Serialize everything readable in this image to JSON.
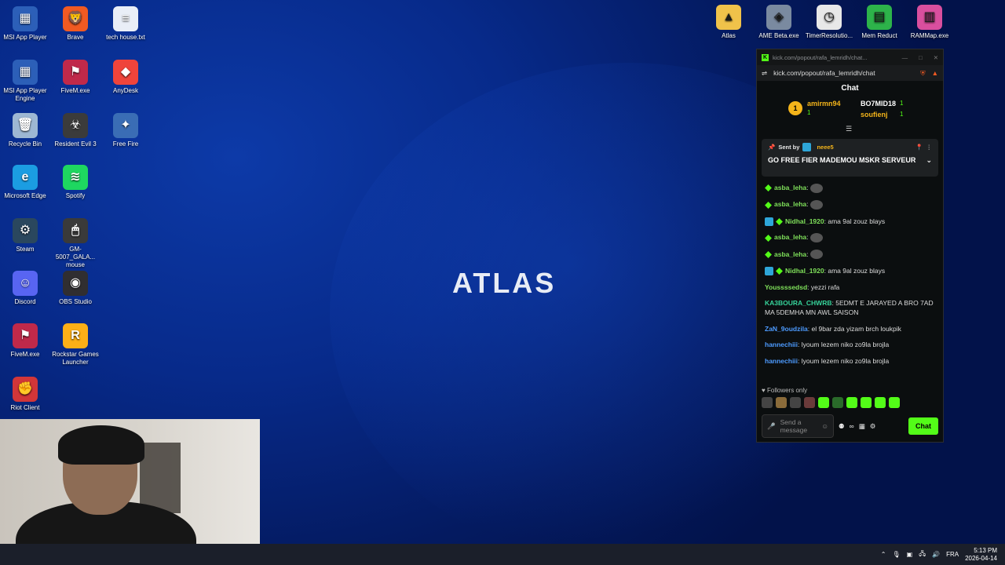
{
  "desktop": {
    "logo_text": "ATLAS",
    "icons_left": [
      {
        "label": "MSI App Player",
        "icon": "msi-app-player-icon",
        "color": "#2c5fb8",
        "glyph": "▦"
      },
      {
        "label": "Brave",
        "icon": "brave-icon",
        "color": "#f15a22",
        "glyph": "🦁"
      },
      {
        "label": "tech house.txt",
        "icon": "text-file-icon",
        "color": "#e9eef7",
        "glyph": "≡"
      },
      {
        "label": "MSI App Player Engine",
        "icon": "msi-engine-icon",
        "color": "#2c5fb8",
        "glyph": "▦"
      },
      {
        "label": "FiveM.exe",
        "icon": "fivem-icon",
        "color": "#c0294a",
        "glyph": "⚑"
      },
      {
        "label": "AnyDesk",
        "icon": "anydesk-icon",
        "color": "#ef443b",
        "glyph": "◆"
      },
      {
        "label": "Recycle Bin",
        "icon": "recycle-bin-icon",
        "color": "#9db7d3",
        "glyph": "🗑"
      },
      {
        "label": "Resident Evil 3",
        "icon": "resident-evil-icon",
        "color": "#3b3b3b",
        "glyph": "☣"
      },
      {
        "label": "Free Fire",
        "icon": "free-fire-icon",
        "color": "#3a6db5",
        "glyph": "✦"
      },
      {
        "label": "Microsoft Edge",
        "icon": "edge-icon",
        "color": "#1b9de2",
        "glyph": "e"
      },
      {
        "label": "Spotify",
        "icon": "spotify-icon",
        "color": "#1ed760",
        "glyph": "≋"
      },
      {
        "label": "Steam",
        "icon": "steam-icon",
        "color": "#2a475e",
        "glyph": "⚙"
      },
      {
        "label": "GM-5007_GALA... mouse",
        "icon": "mouse-app-icon",
        "color": "#3a3a3a",
        "glyph": "🖱"
      },
      {
        "label": "Discord",
        "icon": "discord-icon",
        "color": "#5865f2",
        "glyph": "☺"
      },
      {
        "label": "OBS Studio",
        "icon": "obs-icon",
        "color": "#302e31",
        "glyph": "◉"
      },
      {
        "label": "FiveM.exe",
        "icon": "fivem-icon",
        "color": "#c0294a",
        "glyph": "⚑"
      },
      {
        "label": "Rockstar Games Launcher",
        "icon": "rockstar-icon",
        "color": "#fcaf17",
        "glyph": "R"
      },
      {
        "label": "Riot Client",
        "icon": "riot-icon",
        "color": "#d13639",
        "glyph": "✊"
      }
    ],
    "icons_top": [
      {
        "label": "Atlas",
        "icon": "folder-icon",
        "color": "#f0c24a",
        "glyph": "▲"
      },
      {
        "label": "AME Beta.exe",
        "icon": "ame-icon",
        "color": "#7a8aa0",
        "glyph": "◈"
      },
      {
        "label": "TimerResolutio...",
        "icon": "clock-icon",
        "color": "#e8e8e8",
        "glyph": "◷"
      },
      {
        "label": "Mem Reduct",
        "icon": "mem-reduct-icon",
        "color": "#2db34a",
        "glyph": "▤"
      },
      {
        "label": "RAMMap.exe",
        "icon": "rammap-icon",
        "color": "#d94f9e",
        "glyph": "▥"
      }
    ]
  },
  "chat_window": {
    "tab_title": "kick.com/popout/rafa_lemridh/chat...",
    "url": "kick.com/popout/rafa_lemridh/chat",
    "header": "Chat",
    "leaders": [
      {
        "rank": "1",
        "name": "amirmn94",
        "count": "1"
      },
      {
        "name": "BO7MID18",
        "count": "1"
      },
      {
        "name": "soufienj",
        "count": "1"
      }
    ],
    "pinned": {
      "sent_by_label": "Sent by",
      "sender": "neee5",
      "message": "GO FREE FIER MADEMOU MSKR SERVEUR"
    },
    "messages": [
      {
        "user": "asba_leha",
        "text": "",
        "color": "#7fe05a",
        "emote": true,
        "badges": "g"
      },
      {
        "user": "asba_leha",
        "text": "",
        "color": "#7fe05a",
        "emote": true,
        "badges": "g"
      },
      {
        "user": "Nidhal_1920",
        "text": "ama 9al zouz blays",
        "color": "#7fe05a",
        "emote": false,
        "badges": "bg"
      },
      {
        "user": "asba_leha",
        "text": "",
        "color": "#7fe05a",
        "emote": true,
        "badges": "g"
      },
      {
        "user": "asba_leha",
        "text": "",
        "color": "#7fe05a",
        "emote": true,
        "badges": "g"
      },
      {
        "user": "Nidhal_1920",
        "text": "ama 9al zouz blays",
        "color": "#7fe05a",
        "emote": false,
        "badges": "bg"
      },
      {
        "user": "Youssssedsd",
        "text": "yezzi rafa",
        "color": "#7fe05a",
        "emote": false,
        "badges": ""
      },
      {
        "user": "KA3BOURA_CHWRB",
        "text": "5EDMT E JARAYED A BRO 7AD MA 5DEMHA MN AWL SAISON",
        "color": "#36d39a",
        "emote": false,
        "badges": ""
      },
      {
        "user": "ZaN_9oudzila",
        "text": "el 9bar zda yizam brch loukpik",
        "color": "#4d9bff",
        "emote": false,
        "badges": ""
      },
      {
        "user": "hannechiii",
        "text": "lyoum lezem niko zo9la brojla",
        "color": "#4d9bff",
        "emote": false,
        "badges": ""
      },
      {
        "user": "hannechiii",
        "text": "lyoum lezem niko zo9la brojla",
        "color": "#4d9bff",
        "emote": false,
        "badges": ""
      }
    ],
    "followers_only": "Followers only",
    "input_placeholder": "Send a message",
    "send_label": "Chat"
  },
  "taskbar": {
    "lang": "FRA",
    "time": "5:13 PM",
    "date": "2026-04-14"
  }
}
